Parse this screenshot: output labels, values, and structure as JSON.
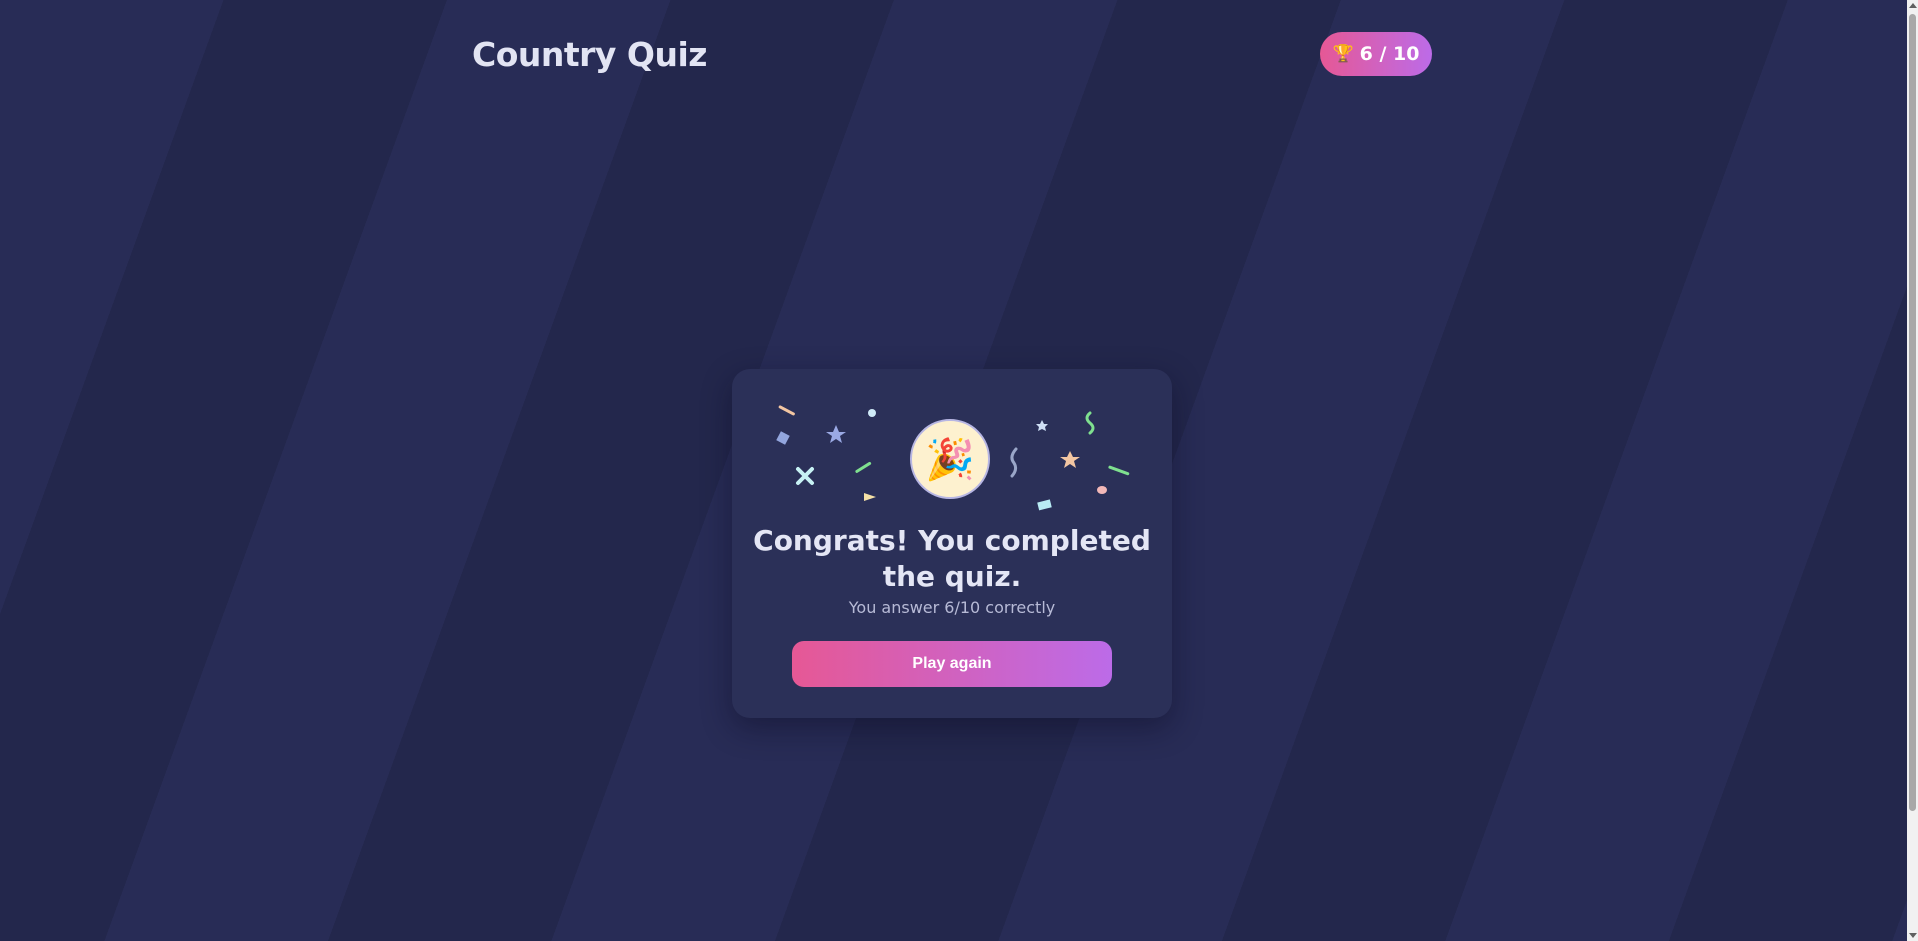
{
  "header": {
    "title": "Country Quiz",
    "score_badge": {
      "icon": "trophy-icon",
      "text": "6 / 10"
    }
  },
  "result_card": {
    "medal_icon": "party-popper-icon",
    "heading": "Congrats! You completed the quiz.",
    "subtext": "You answer 6/10 correctly",
    "play_again_label": "Play again"
  },
  "colors": {
    "background": "#262a52",
    "card": "#2b3058",
    "gradient_start": "#e65895",
    "gradient_end": "#bc6be8",
    "text_primary": "#e4e6f5",
    "text_secondary": "#b7bad6"
  }
}
